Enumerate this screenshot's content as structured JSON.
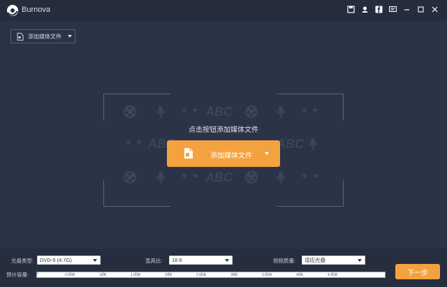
{
  "app": {
    "title": "Burnova"
  },
  "titlebar_icons": [
    "save-icon",
    "user-icon",
    "facebook-icon",
    "message-icon",
    "minimize-icon",
    "maximize-icon",
    "close-icon"
  ],
  "toolbar": {
    "add_media_label": "添加媒体文件"
  },
  "drop_area": {
    "hint": "点击按钮添加媒体文件",
    "add_button_label": "添加媒体文件",
    "watermark_text": "ABC"
  },
  "bottom": {
    "disc_type_label": "光盘类型:",
    "disc_type_value": "DVD-5 (4.7G)",
    "aspect_label": "宽高比:",
    "aspect_value": "16:9",
    "quality_label": "视频质量:",
    "quality_value": "适应光盘",
    "capacity_label": "预计容量:",
    "capacity_ticks": [
      "0.5GB",
      "1GB",
      "1.5GB",
      "2GB",
      "2.5GB",
      "3GB",
      "3.5GB",
      "4GB",
      "4.5GB"
    ],
    "next_label": "下一步"
  },
  "colors": {
    "accent": "#f4a240",
    "background": "#2b3446",
    "titlebar": "#252d3d"
  }
}
